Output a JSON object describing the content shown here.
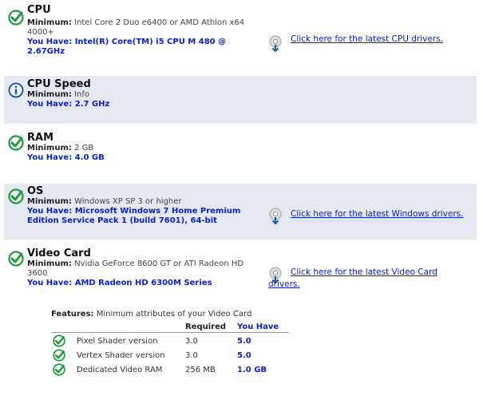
{
  "colors": {
    "accent_link": "#0a22c8",
    "check_green": "#1e9b3a",
    "info_blue": "#1c5fa8",
    "shaded_row": "#e6e9f2"
  },
  "labels": {
    "minimum": "Minimum:",
    "you_have": "You Have:"
  },
  "sections": [
    {
      "title": "CPU",
      "status": "pass",
      "icon": "check-icon",
      "min_lines": [
        "Intel Core 2 Duo e6400 or AMD Athlon x64",
        "4000+"
      ],
      "have_lines": [
        "Intel(R) Core(TM) i5 CPU M 480 @",
        "2.67GHz"
      ],
      "driver_link": [
        "Click here for the latest CPU drivers."
      ]
    },
    {
      "title": "CPU Speed",
      "status": "info",
      "icon": "info-icon",
      "min_lines": [
        "Info"
      ],
      "have_lines": [
        "2.7 GHz"
      ]
    },
    {
      "title": "RAM",
      "status": "pass",
      "icon": "check-icon",
      "min_lines": [
        "2 GB"
      ],
      "have_lines": [
        "4.0 GB"
      ]
    },
    {
      "title": "OS",
      "status": "pass",
      "icon": "check-icon",
      "min_lines": [
        "Windows XP SP 3 or higher"
      ],
      "have_lines": [
        "Microsoft Windows 7 Home Premium",
        "Edition Service Pack 1 (build 7601), 64-bit"
      ],
      "driver_link": [
        "Click here for the latest Windows drivers."
      ]
    },
    {
      "title": "Video Card",
      "status": "pass",
      "icon": "check-icon",
      "min_lines": [
        "Nvidia GeForce 8600 GT or ATI Radeon HD",
        "3600"
      ],
      "have_lines": [
        "AMD Radeon HD 6300M Series"
      ],
      "driver_link": [
        "Click here for the latest Video Card",
        "drivers."
      ]
    }
  ],
  "features": {
    "title_bold": "Features:",
    "title_rest": "Minimum attributes of your Video Card",
    "col_required": "Required",
    "col_have": "You Have",
    "rows": [
      {
        "name": "Pixel Shader version",
        "required": "3.0",
        "have": "5.0"
      },
      {
        "name": "Vertex Shader version",
        "required": "3.0",
        "have": "5.0"
      },
      {
        "name": "Dedicated Video RAM",
        "required": "256 MB",
        "have": "1.0 GB"
      }
    ]
  }
}
